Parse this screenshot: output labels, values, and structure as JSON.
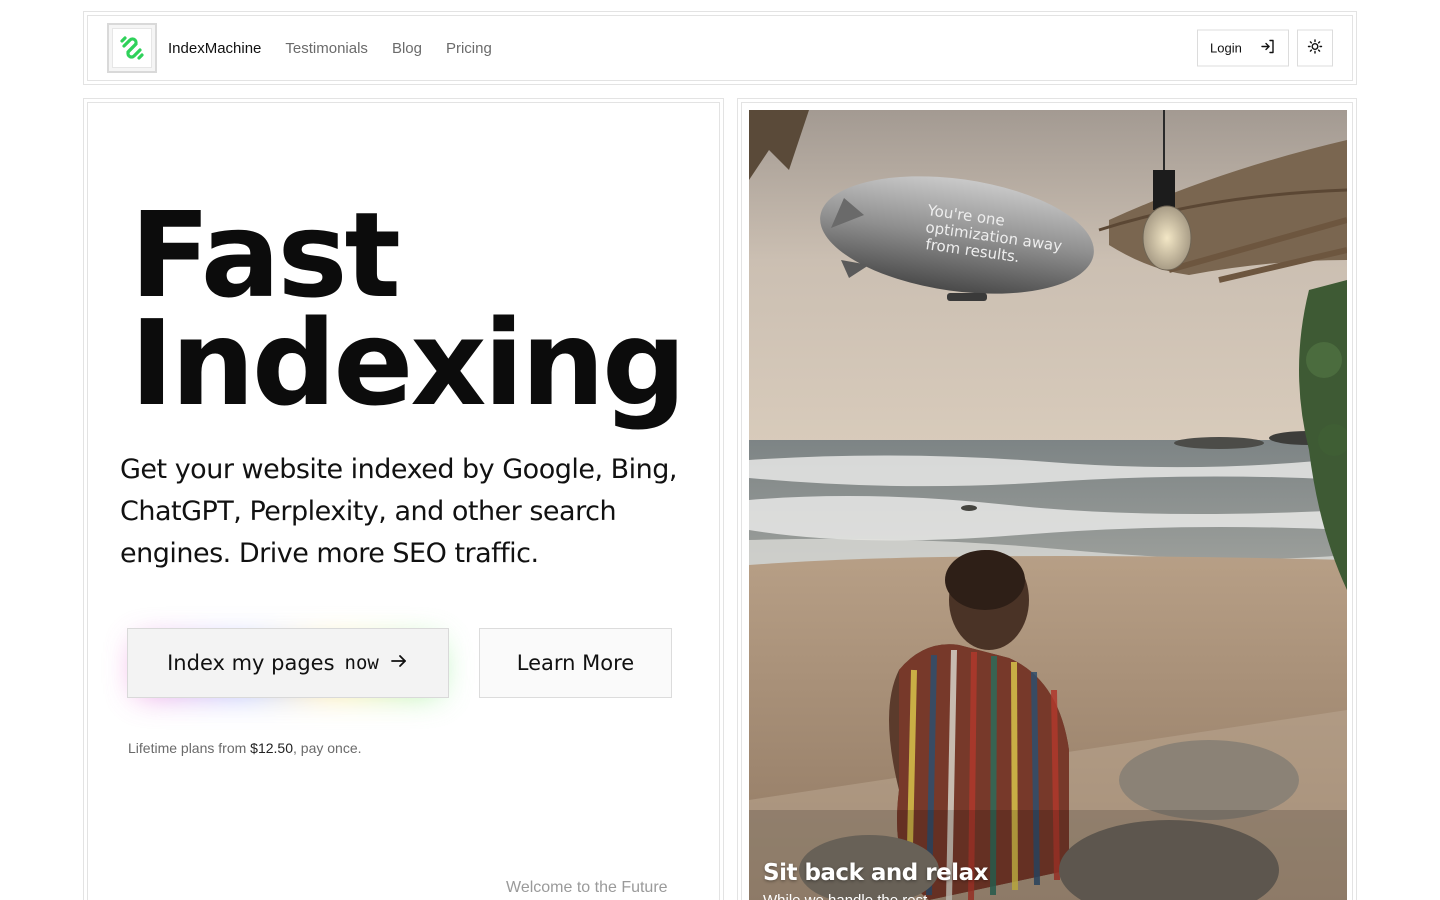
{
  "nav": {
    "brand": "IndexMachine",
    "links": [
      "Testimonials",
      "Blog",
      "Pricing"
    ],
    "login_label": "Login",
    "logo_icon": "link-icon",
    "login_icon": "log-in-icon",
    "theme_icon": "sun-icon"
  },
  "hero": {
    "title_line1": "Fast",
    "title_line2": "Indexing",
    "subtitle": "Get your website indexed by Google, Bing, ChatGPT, Perplexity, and other search engines. Drive more SEO traffic.",
    "cta_primary_text": "Index my pages",
    "cta_primary_emphasis": "now",
    "cta_primary_icon": "arrow-right-icon",
    "cta_secondary": "Learn More",
    "pricing_prefix": "Lifetime plans from ",
    "pricing_amount": "$12.50",
    "pricing_suffix": ", pay once.",
    "welcome": "Welcome to the Future"
  },
  "photo": {
    "blimp_text_line1": "You're one",
    "blimp_text_line2": "optimization away",
    "blimp_text_line3": "from results.",
    "caption": "Sit back and relax",
    "subcaption": "While we handle the rest"
  },
  "colors": {
    "accent_green": "#2fd15a",
    "border": "#e3e3e3",
    "text": "#111111",
    "muted": "#6b6b6b"
  }
}
